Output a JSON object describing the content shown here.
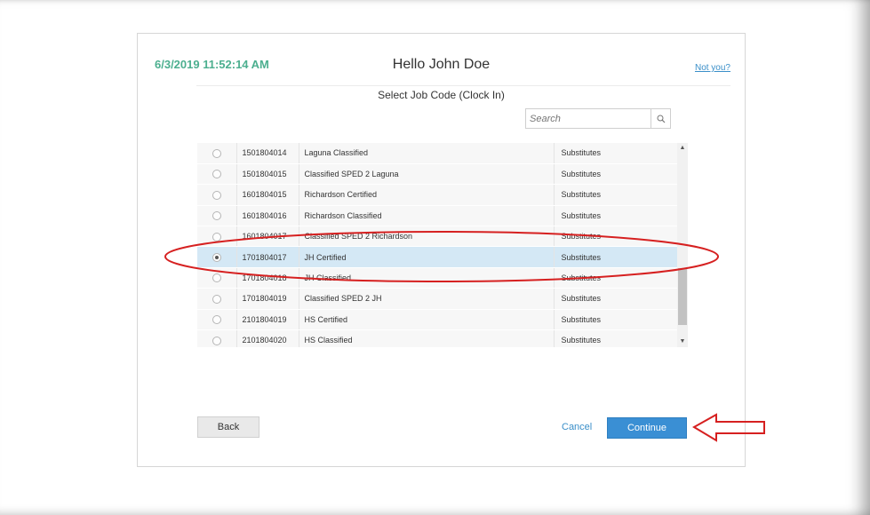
{
  "header": {
    "timestamp": "6/3/2019 11:52:14 AM",
    "greeting": "Hello John Doe",
    "not_you_link": "Not you?",
    "subtitle": "Select Job Code (Clock In)"
  },
  "search": {
    "placeholder": "Search",
    "value": ""
  },
  "job_codes": {
    "rows": [
      {
        "code": "1501804014",
        "name": "Laguna Classified",
        "category": "Substitutes",
        "selected": false
      },
      {
        "code": "1501804015",
        "name": "Classified SPED 2 Laguna",
        "category": "Substitutes",
        "selected": false
      },
      {
        "code": "1601804015",
        "name": "Richardson Certified",
        "category": "Substitutes",
        "selected": false
      },
      {
        "code": "1601804016",
        "name": "Richardson Classified",
        "category": "Substitutes",
        "selected": false
      },
      {
        "code": "1601804017",
        "name": "Classified SPED 2 Richardson",
        "category": "Substitutes",
        "selected": false
      },
      {
        "code": "1701804017",
        "name": "JH Certified",
        "category": "Substitutes",
        "selected": true
      },
      {
        "code": "1701804018",
        "name": "JH Classified",
        "category": "Substitutes",
        "selected": false
      },
      {
        "code": "1701804019",
        "name": "Classified SPED 2 JH",
        "category": "Substitutes",
        "selected": false
      },
      {
        "code": "2101804019",
        "name": "HS Certified",
        "category": "Substitutes",
        "selected": false
      },
      {
        "code": "2101804020",
        "name": "HS Classified",
        "category": "Substitutes",
        "selected": false
      }
    ]
  },
  "footer": {
    "back_label": "Back",
    "cancel_label": "Cancel",
    "continue_label": "Continue"
  },
  "colors": {
    "timestamp": "#4caf8f",
    "link": "#3a8fc9",
    "primary_button": "#3a8fd4",
    "selected_row": "#d4e8f5",
    "annotation": "#d62020"
  },
  "icons": {
    "search": "search-icon",
    "scroll_up": "scroll-up-arrow-icon",
    "scroll_down": "scroll-down-arrow-icon"
  }
}
